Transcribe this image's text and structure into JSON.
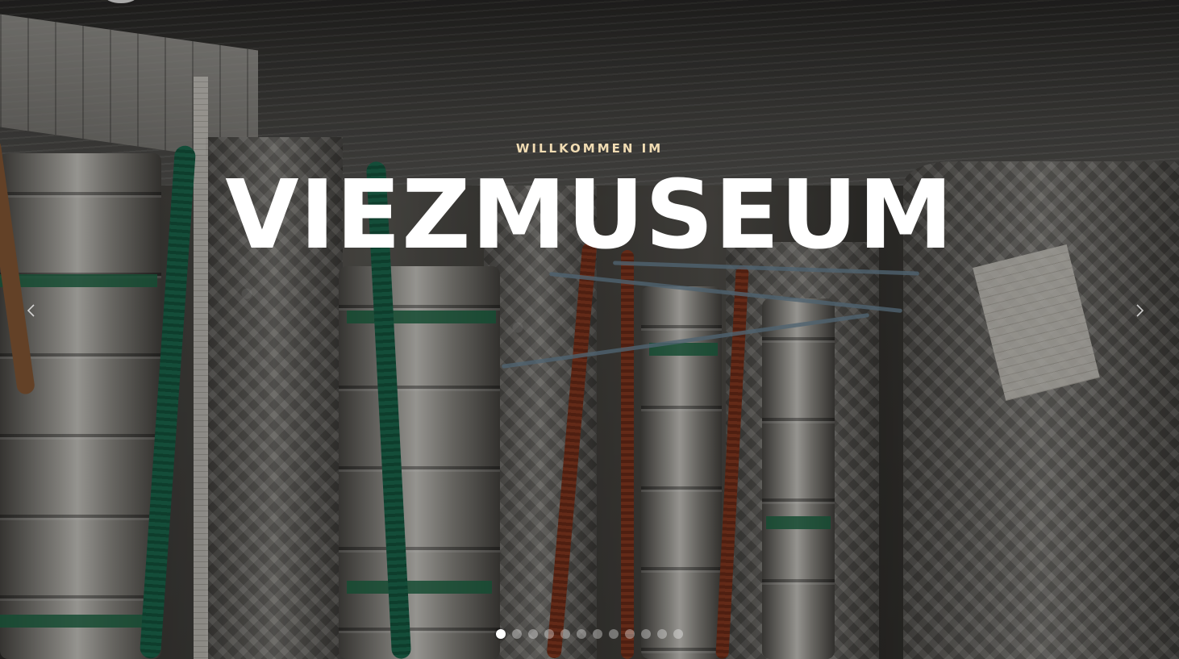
{
  "hero": {
    "eyebrow": "WILLKOMMEN IM",
    "headline": "VIEZMUSEUM",
    "eyebrow_color": "#f1dcb3",
    "headline_color": "#ffffff"
  },
  "slider": {
    "prev_icon": "chevron-left-icon",
    "next_icon": "chevron-right-icon",
    "slide_count": 12,
    "active_slide": 1
  }
}
